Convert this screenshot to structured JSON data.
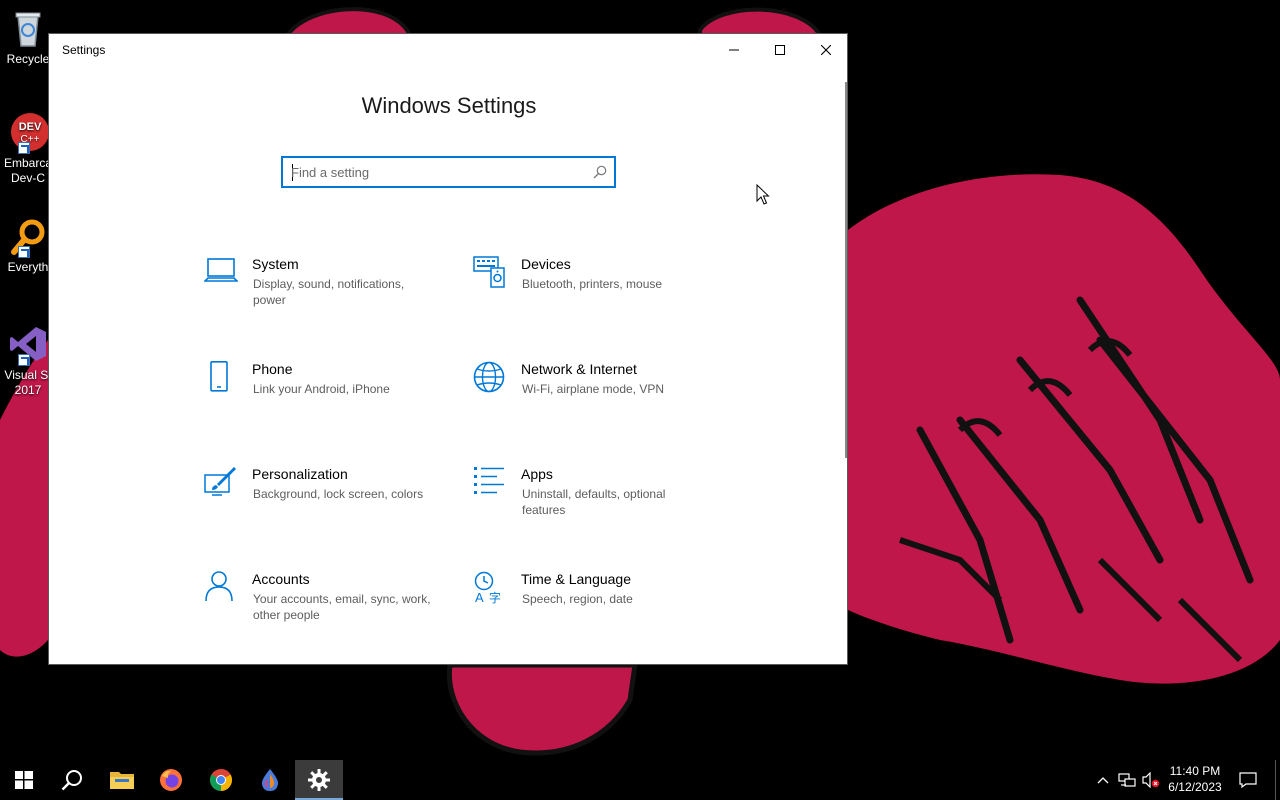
{
  "desktop": {
    "icons": [
      {
        "label": "Recycle",
        "icon": "recycle-bin-icon"
      },
      {
        "label": "Embarca",
        "label2": "Dev-C",
        "icon": "dev-cpp-icon"
      },
      {
        "label": "Everyth",
        "icon": "everything-search-icon"
      },
      {
        "label": "Visual St",
        "label2": "2017",
        "icon": "visual-studio-icon"
      }
    ]
  },
  "window": {
    "title": "Settings",
    "heading": "Windows Settings",
    "search_placeholder": "Find a setting",
    "search_value": "",
    "accent_color": "#0078d7",
    "tiles": [
      {
        "title": "System",
        "desc": "Display, sound, notifications, power",
        "icon": "laptop-icon"
      },
      {
        "title": "Devices",
        "desc": "Bluetooth, printers, mouse",
        "icon": "devices-keyboard-icon"
      },
      {
        "title": "Phone",
        "desc": "Link your Android, iPhone",
        "icon": "phone-icon"
      },
      {
        "title": "Network & Internet",
        "desc": "Wi-Fi, airplane mode, VPN",
        "icon": "globe-icon"
      },
      {
        "title": "Personalization",
        "desc": "Background, lock screen, colors",
        "icon": "paintbrush-icon"
      },
      {
        "title": "Apps",
        "desc": "Uninstall, defaults, optional features",
        "icon": "apps-list-icon"
      },
      {
        "title": "Accounts",
        "desc": "Your accounts, email, sync, work, other people",
        "icon": "person-icon"
      },
      {
        "title": "Time & Language",
        "desc": "Speech, region, date",
        "icon": "time-language-icon"
      }
    ]
  },
  "taskbar": {
    "items": [
      {
        "name": "start",
        "icon": "windows-start-icon"
      },
      {
        "name": "search",
        "icon": "search-icon"
      },
      {
        "name": "file-explorer",
        "icon": "folder-icon"
      },
      {
        "name": "firefox",
        "icon": "firefox-icon"
      },
      {
        "name": "chrome",
        "icon": "chrome-icon"
      },
      {
        "name": "paint-app",
        "icon": "droplet-app-icon"
      },
      {
        "name": "settings",
        "icon": "gear-icon",
        "active": true
      }
    ],
    "time": "11:40 PM",
    "date": "6/12/2023"
  }
}
